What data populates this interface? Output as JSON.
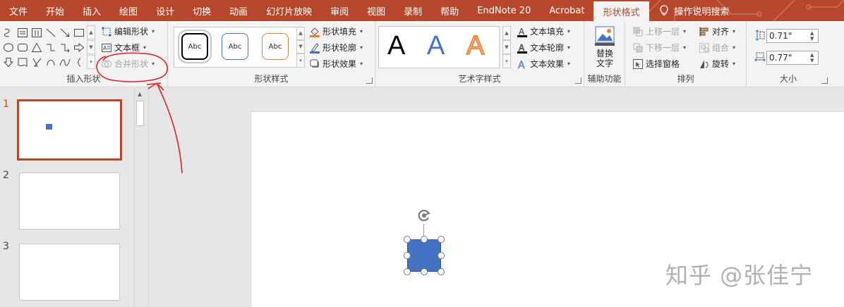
{
  "tabs": [
    {
      "label": "文件"
    },
    {
      "label": "开始"
    },
    {
      "label": "插入"
    },
    {
      "label": "绘图"
    },
    {
      "label": "设计"
    },
    {
      "label": "切换"
    },
    {
      "label": "动画"
    },
    {
      "label": "幻灯片放映"
    },
    {
      "label": "审阅"
    },
    {
      "label": "视图"
    },
    {
      "label": "录制"
    },
    {
      "label": "帮助"
    },
    {
      "label": "EndNote 20"
    },
    {
      "label": "Acrobat"
    },
    {
      "label": "形状格式",
      "active": true
    }
  ],
  "tell_me": {
    "label": "操作说明搜索",
    "icon": "lightbulb-icon"
  },
  "ribbon": {
    "insert_shapes": {
      "label": "插入形状",
      "edit_shape": "编辑形状",
      "text_box": "文本框",
      "merge_shapes": "合并形状"
    },
    "shape_styles": {
      "label": "形状样式",
      "presets": [
        "Abc",
        "Abc",
        "Abc"
      ],
      "fill": "形状填充",
      "outline": "形状轮廓",
      "effects": "形状效果"
    },
    "wordart_styles": {
      "label": "艺术字样式",
      "presets": [
        "A",
        "A",
        "A"
      ],
      "text_fill": "文本填充",
      "text_outline": "文本轮廓",
      "text_effects": "文本效果"
    },
    "accessibility": {
      "label": "辅助功能",
      "alt_text_line1": "替换",
      "alt_text_line2": "文字"
    },
    "arrange": {
      "label": "排列",
      "bring_forward": "上移一层",
      "send_backward": "下移一层",
      "selection_pane": "选择窗格",
      "align": "对齐",
      "group": "组合",
      "rotate": "旋转"
    },
    "size": {
      "label": "大小",
      "height": "0.71\"",
      "width": "0.77\""
    }
  },
  "slides": [
    {
      "number": "1",
      "active": true
    },
    {
      "number": "2"
    },
    {
      "number": "3"
    }
  ],
  "watermark": "知乎 @张佳宁",
  "colors": {
    "accent": "#b7472a",
    "shape_fill": "#4472c4",
    "annotation": "#e02020"
  }
}
